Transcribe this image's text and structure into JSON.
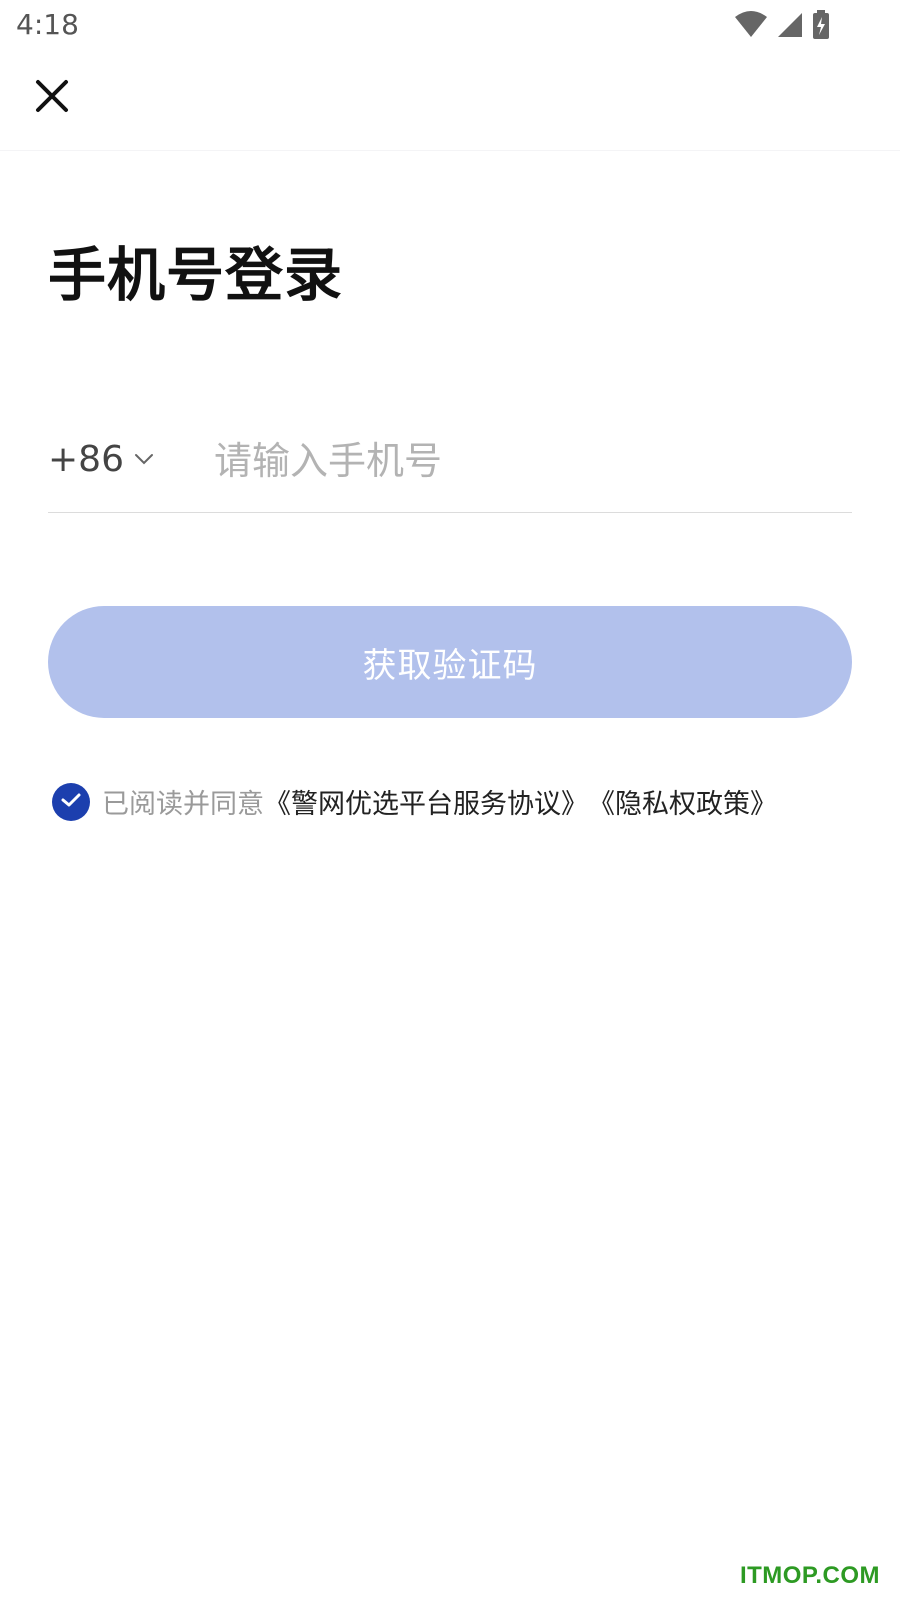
{
  "status_bar": {
    "time": "4:18",
    "icons": [
      "wifi-icon",
      "cellular-signal-icon",
      "battery-charging-icon"
    ]
  },
  "top_bar": {
    "close_icon": "close-icon"
  },
  "title": "手机号登录",
  "phone": {
    "country_code": "+86",
    "dropdown_icon": "chevron-down-icon",
    "placeholder": "请输入手机号",
    "value": ""
  },
  "submit": {
    "label": "获取验证码",
    "color": "#b2c1ec"
  },
  "agreement": {
    "checked": true,
    "checkbox_color": "#1c3fae",
    "prefix": "已阅读并同意",
    "service_link": "《警网优选平台服务协议》",
    "privacy_link": "《隐私权政策》"
  },
  "watermark": "ITMOP.COM"
}
